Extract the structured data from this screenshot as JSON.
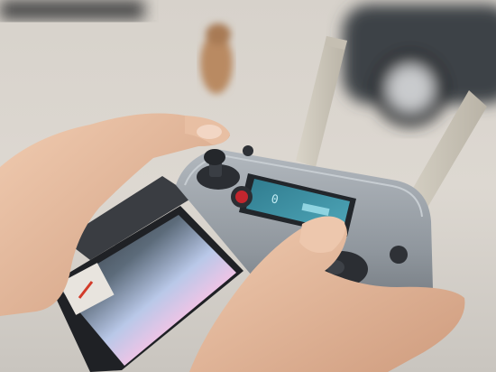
{
  "scene": {
    "subject": "drone-remote-controller",
    "lcd_readout": "0",
    "colors": {
      "background": "#d9d6d1",
      "controller_body": "#9aa1a8",
      "lcd_screen": "#3d8fa3",
      "skin": "#e2b69a",
      "red_button": "#c2262e"
    }
  }
}
